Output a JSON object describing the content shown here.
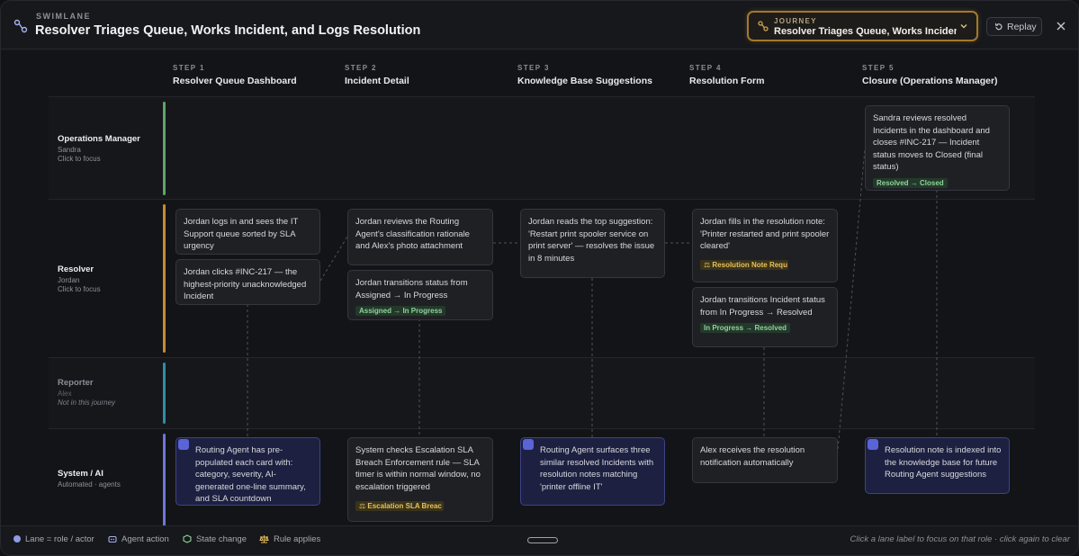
{
  "header": {
    "eyebrow": "SWIMLANE",
    "title": "Resolver Triages Queue, Works Incident, and Logs Resolution",
    "journey_label": "JOURNEY",
    "journey_value": "Resolver Triages Queue, Works Incident,",
    "replay_label": "Replay",
    "icons": {
      "swimlane": "swimlane-icon",
      "journey": "route-icon",
      "replay": "replay-icon",
      "close": "close-icon",
      "chevron": "chevron-down-icon"
    },
    "accent": "#a5782b"
  },
  "steps": [
    {
      "num": "STEP 1",
      "name": "Resolver Queue Dashboard"
    },
    {
      "num": "STEP 2",
      "name": "Incident Detail"
    },
    {
      "num": "STEP 3",
      "name": "Knowledge Base Suggestions"
    },
    {
      "num": "STEP 4",
      "name": "Resolution Form"
    },
    {
      "num": "STEP 5",
      "name": "Closure (Operations Manager)"
    }
  ],
  "lanes": [
    {
      "title": "Operations Manager",
      "sub": "Sandra",
      "focus": "Click to focus",
      "color": "#5fa466"
    },
    {
      "title": "Resolver",
      "sub": "Jordan",
      "focus": "Click to focus",
      "color": "#c98a2e"
    },
    {
      "title": "Reporter",
      "sub": "Alex",
      "focus": "Not in this journey",
      "color": "#2f8ea3"
    },
    {
      "title": "System / AI",
      "sub": "Automated · agents",
      "focus": "",
      "color": "#6d77d8"
    }
  ],
  "cards": {
    "ops_step5": {
      "text": "Sandra reviews resolved Incidents in the dashboard and closes #INC-217 — Incident status moves to Closed (final status)",
      "badge": "Resolved → Closed"
    },
    "res_s1_a": {
      "text": "Jordan logs in and sees the IT Support queue sorted by SLA urgency"
    },
    "res_s1_b": {
      "text": "Jordan clicks #INC-217 — the highest-priority unacknowledged Incident"
    },
    "res_s2_a": {
      "text": "Jordan reviews the Routing Agent's classification rationale and Alex's photo attachment"
    },
    "res_s2_b": {
      "text": "Jordan transitions status from Assigned → In Progress",
      "badge": "Assigned → In Progress"
    },
    "res_s3": {
      "text": "Jordan reads the top suggestion: 'Restart print spooler service on print server' — resolves the issue in 8 minutes"
    },
    "res_s4_a": {
      "text": "Jordan fills in the resolution note: 'Printer restarted and print spooler cleared'",
      "badge": "⚖ Resolution Note Requ"
    },
    "res_s4_b": {
      "text": "Jordan transitions Incident status from In Progress → Resolved",
      "badge": "In Progress → Resolved"
    },
    "sys_s1": {
      "text": "Routing Agent has pre-populated each card with: category, severity, AI-generated one-line summary, and SLA countdown"
    },
    "sys_s2": {
      "text": "System checks Escalation SLA Breach Enforcement rule — SLA timer is within normal window, no escalation triggered",
      "badge": "⚖ Escalation SLA Breac"
    },
    "sys_s3": {
      "text": "Routing Agent surfaces three similar resolved Incidents with resolution notes matching 'printer offline IT'"
    },
    "sys_s4": {
      "text": "Alex receives the resolution notification automatically"
    },
    "sys_s5": {
      "text": "Resolution note is indexed into the knowledge base for future Routing Agent suggestions"
    }
  },
  "footer": {
    "legend": [
      {
        "label": "Lane = role / actor",
        "icon": "lane-dot-icon"
      },
      {
        "label": "Agent action",
        "icon": "agent-icon"
      },
      {
        "label": "State change",
        "icon": "state-change-icon"
      },
      {
        "label": "Rule applies",
        "icon": "rule-icon"
      }
    ],
    "hint": "Click a lane label to focus on that role · click again to clear"
  }
}
